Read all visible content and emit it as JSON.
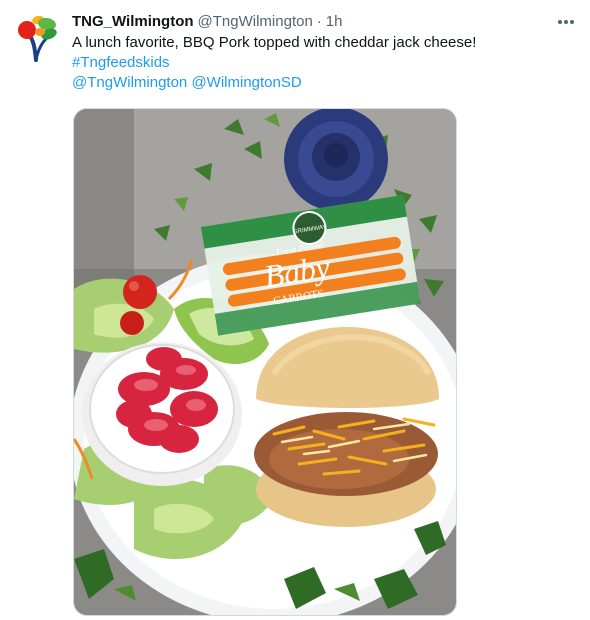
{
  "tweet": {
    "author": {
      "display_name": "TNG_Wilmington",
      "handle": "@TngWilmington",
      "avatar_icon": "tree-logo-icon"
    },
    "separator": "·",
    "timestamp": "1h",
    "text": "A lunch favorite, BBQ Pork topped with cheddar jack cheese!",
    "hashtag": "#Tngfeedskids",
    "mentions": [
      "@TngWilmington",
      "@WilmingtonSD"
    ],
    "more_icon": "ellipsis-icon",
    "photo": {
      "carrot_bag_label": "Baby",
      "carrot_bag_sublabel": "CARROTS",
      "carrot_bag_brand": "GRIMMWAY",
      "carrot_bag_top": "Fresh Peeled"
    }
  },
  "colors": {
    "link": "#1d9bf0",
    "secondary_text": "#536471",
    "primary_text": "#0f1419"
  }
}
